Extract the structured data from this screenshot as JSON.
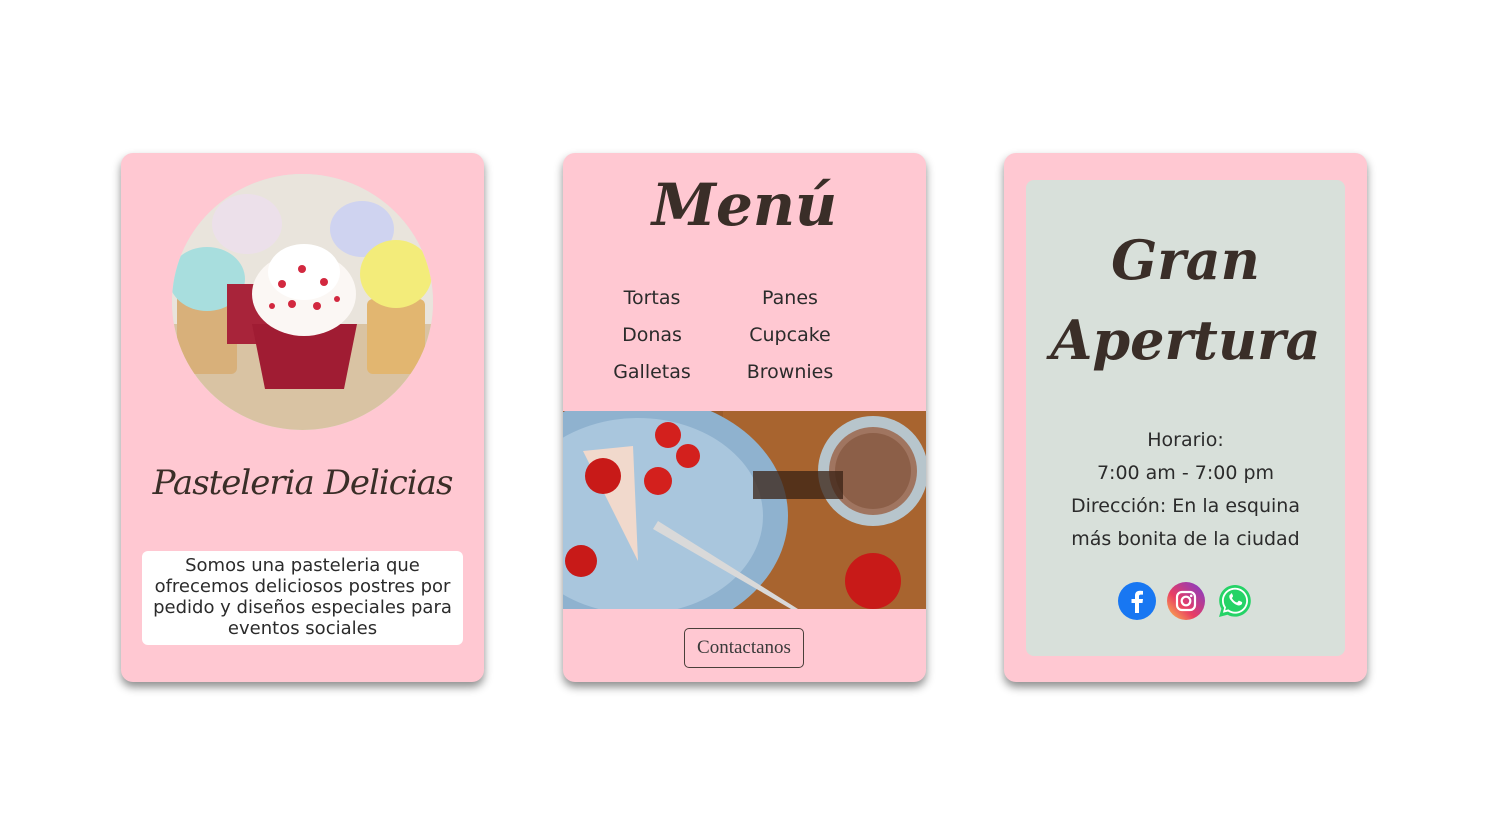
{
  "card_bakery": {
    "photo_icon": "cupcakes-photo",
    "name": "Pasteleria Delicias",
    "description": "Somos una pasteleria que ofrecemos deliciosos postres por pedido y diseños especiales para eventos sociales"
  },
  "card_menu": {
    "title": "Menú",
    "items_left": [
      "Tortas",
      "Donas",
      "Galletas"
    ],
    "items_right": [
      "Panes",
      "Cupcake",
      "Brownies"
    ],
    "photo_icon": "strawberry-cake-coffee-photo",
    "contact_label": "Contactanos"
  },
  "card_opening": {
    "title_line1": "Gran",
    "title_line2": "Apertura",
    "hours_label": "Horario:",
    "hours_value": "7:00 am - 7:00 pm",
    "address_line1": "Dirección: En la esquina",
    "address_line2": "más bonita de la ciudad",
    "social": [
      "facebook-icon",
      "instagram-icon",
      "whatsapp-icon"
    ]
  },
  "colors": {
    "card_bg": "#ffc8d2",
    "panel_bg": "#d8e0da",
    "title_text": "#3a2e28"
  }
}
